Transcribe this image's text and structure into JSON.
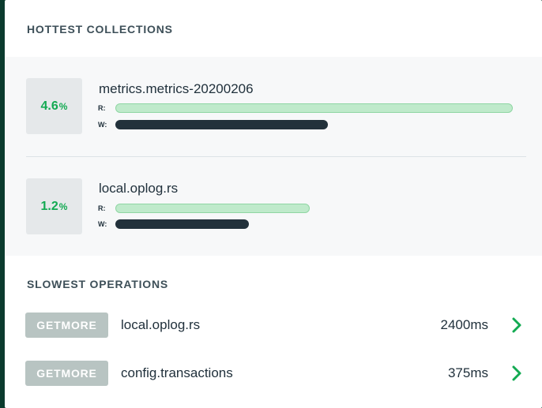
{
  "hottest": {
    "title": "HOTTEST COLLECTIONS",
    "collections": [
      {
        "name": "metrics.metrics-20200206",
        "percent": "4.6",
        "percent_unit": "%",
        "read_label": "R:",
        "write_label": "W:",
        "read_fraction": 1.0,
        "write_fraction": 0.535
      },
      {
        "name": "local.oplog.rs",
        "percent": "1.2",
        "percent_unit": "%",
        "read_label": "R:",
        "write_label": "W:",
        "read_fraction": 0.49,
        "write_fraction": 0.335
      }
    ]
  },
  "slowest": {
    "title": "SLOWEST OPERATIONS",
    "operations": [
      {
        "type": "GETMORE",
        "namespace": "local.oplog.rs",
        "duration": "2400ms",
        "icon": "chevron-right-icon"
      },
      {
        "type": "GETMORE",
        "namespace": "config.transactions",
        "duration": "375ms",
        "icon": "chevron-right-icon"
      }
    ]
  },
  "colors": {
    "accent_green": "#13aa52",
    "read_bar": "#bfeacb",
    "write_bar": "#22313b",
    "badge_bg": "#b8c4c2"
  }
}
